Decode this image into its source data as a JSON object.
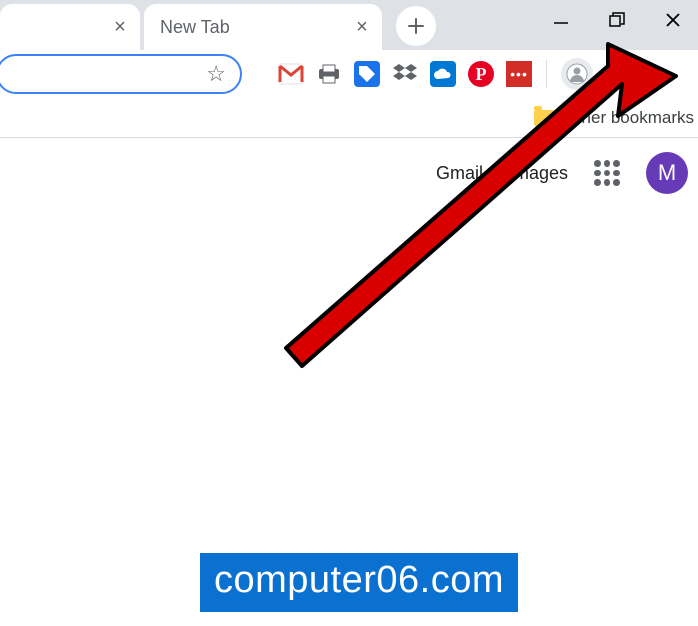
{
  "tabs": {
    "tab1_close": "×",
    "tab2_title": "New Tab",
    "tab2_close": "×"
  },
  "window": {
    "new_tab_glyph": "+",
    "minimize_glyph": "—",
    "maximize_glyph": "❐",
    "close_glyph": "✕"
  },
  "omnibox": {
    "value": "",
    "star_glyph": "☆"
  },
  "extensions": {
    "gmail": "M",
    "print": "⎙",
    "tag_label": "⁞⁞",
    "dropbox": "⬧",
    "onedrive": "☁",
    "pinterest": "P",
    "lastpass": "•••"
  },
  "bookmarks": {
    "other_label": "Other bookmarks"
  },
  "ntp": {
    "gmail_link": "Gmail",
    "images_link": "Images",
    "avatar_initial": "M"
  },
  "watermark": {
    "text": "computer06.com"
  }
}
